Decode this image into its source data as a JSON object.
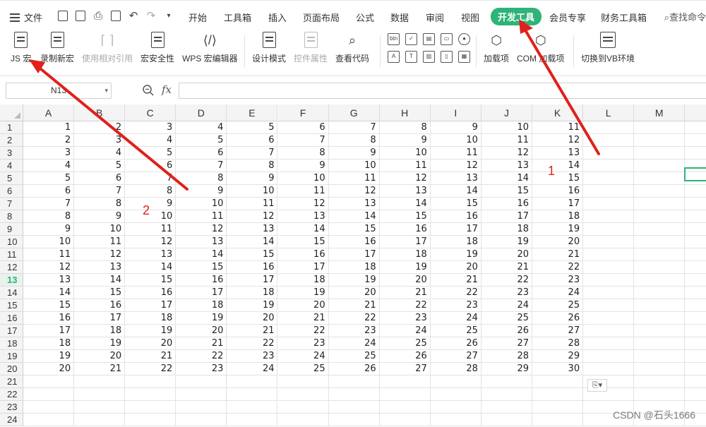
{
  "menubar": {
    "file_label": "文件",
    "tabs": [
      "开始",
      "工具箱",
      "插入",
      "页面布局",
      "公式",
      "数据",
      "审阅",
      "视图",
      "开发工具",
      "会员专享",
      "财务工具箱"
    ],
    "active_tab": "开发工具",
    "search_label": "查找命令"
  },
  "ribbon": {
    "js_macro": "JS 宏",
    "record_macro": "录制新宏",
    "relative_ref": "使用相对引用",
    "macro_security": "宏安全性",
    "wps_macro_editor": "WPS 宏编辑器",
    "design_mode": "设计模式",
    "control_props": "控件属性",
    "view_code": "查看代码",
    "addins": "加载项",
    "com_addins": "COM 加载项",
    "switch_vb": "切换到VB环境",
    "ctl_btn": "btn",
    "ctl_a": "A",
    "ctl_t": "T",
    "vb_badge": "VB"
  },
  "formula_bar": {
    "name_box": "N13",
    "fx": "fx",
    "value": ""
  },
  "sheet": {
    "columns": [
      "A",
      "B",
      "C",
      "D",
      "E",
      "F",
      "G",
      "H",
      "I",
      "J",
      "K",
      "L",
      "M"
    ],
    "rows": [
      "1",
      "2",
      "3",
      "4",
      "5",
      "6",
      "7",
      "8",
      "9",
      "10",
      "11",
      "12",
      "13",
      "14",
      "15",
      "16",
      "17",
      "18",
      "19",
      "20",
      "21",
      "22",
      "23",
      "24"
    ],
    "active_row": "13",
    "data": [
      [
        1,
        2,
        3,
        4,
        5,
        6,
        7,
        8,
        9,
        10,
        11
      ],
      [
        2,
        3,
        4,
        5,
        6,
        7,
        8,
        9,
        10,
        11,
        12
      ],
      [
        3,
        4,
        5,
        6,
        7,
        8,
        9,
        10,
        11,
        12,
        13
      ],
      [
        4,
        5,
        6,
        7,
        8,
        9,
        10,
        11,
        12,
        13,
        14
      ],
      [
        5,
        6,
        7,
        8,
        9,
        10,
        11,
        12,
        13,
        14,
        15
      ],
      [
        6,
        7,
        8,
        9,
        10,
        11,
        12,
        13,
        14,
        15,
        16
      ],
      [
        7,
        8,
        9,
        10,
        11,
        12,
        13,
        14,
        15,
        16,
        17
      ],
      [
        8,
        9,
        10,
        11,
        12,
        13,
        14,
        15,
        16,
        17,
        18
      ],
      [
        9,
        10,
        11,
        12,
        13,
        14,
        15,
        16,
        17,
        18,
        19
      ],
      [
        10,
        11,
        12,
        13,
        14,
        15,
        16,
        17,
        18,
        19,
        20
      ],
      [
        11,
        12,
        13,
        14,
        15,
        16,
        17,
        18,
        19,
        20,
        21
      ],
      [
        12,
        13,
        14,
        15,
        16,
        17,
        18,
        19,
        20,
        21,
        22
      ],
      [
        13,
        14,
        15,
        16,
        17,
        18,
        19,
        20,
        21,
        22,
        23
      ],
      [
        14,
        15,
        16,
        17,
        18,
        19,
        20,
        21,
        22,
        23,
        24
      ],
      [
        15,
        16,
        17,
        18,
        19,
        20,
        21,
        22,
        23,
        24,
        25
      ],
      [
        16,
        17,
        18,
        19,
        20,
        21,
        22,
        23,
        24,
        25,
        26
      ],
      [
        17,
        18,
        19,
        20,
        21,
        22,
        23,
        24,
        25,
        26,
        27
      ],
      [
        18,
        19,
        20,
        21,
        22,
        23,
        24,
        25,
        26,
        27,
        28
      ],
      [
        19,
        20,
        21,
        22,
        23,
        24,
        25,
        26,
        27,
        28,
        29
      ],
      [
        20,
        21,
        22,
        23,
        24,
        25,
        26,
        27,
        28,
        29,
        30
      ]
    ]
  },
  "annotations": {
    "label_1": "1",
    "label_2": "2",
    "color": "#e0201b"
  },
  "watermark": "CSDN @石头1666",
  "paste_options_icon": "paste-options-icon",
  "colors": {
    "accent": "#2eb378",
    "annotation": "#e0201b"
  }
}
